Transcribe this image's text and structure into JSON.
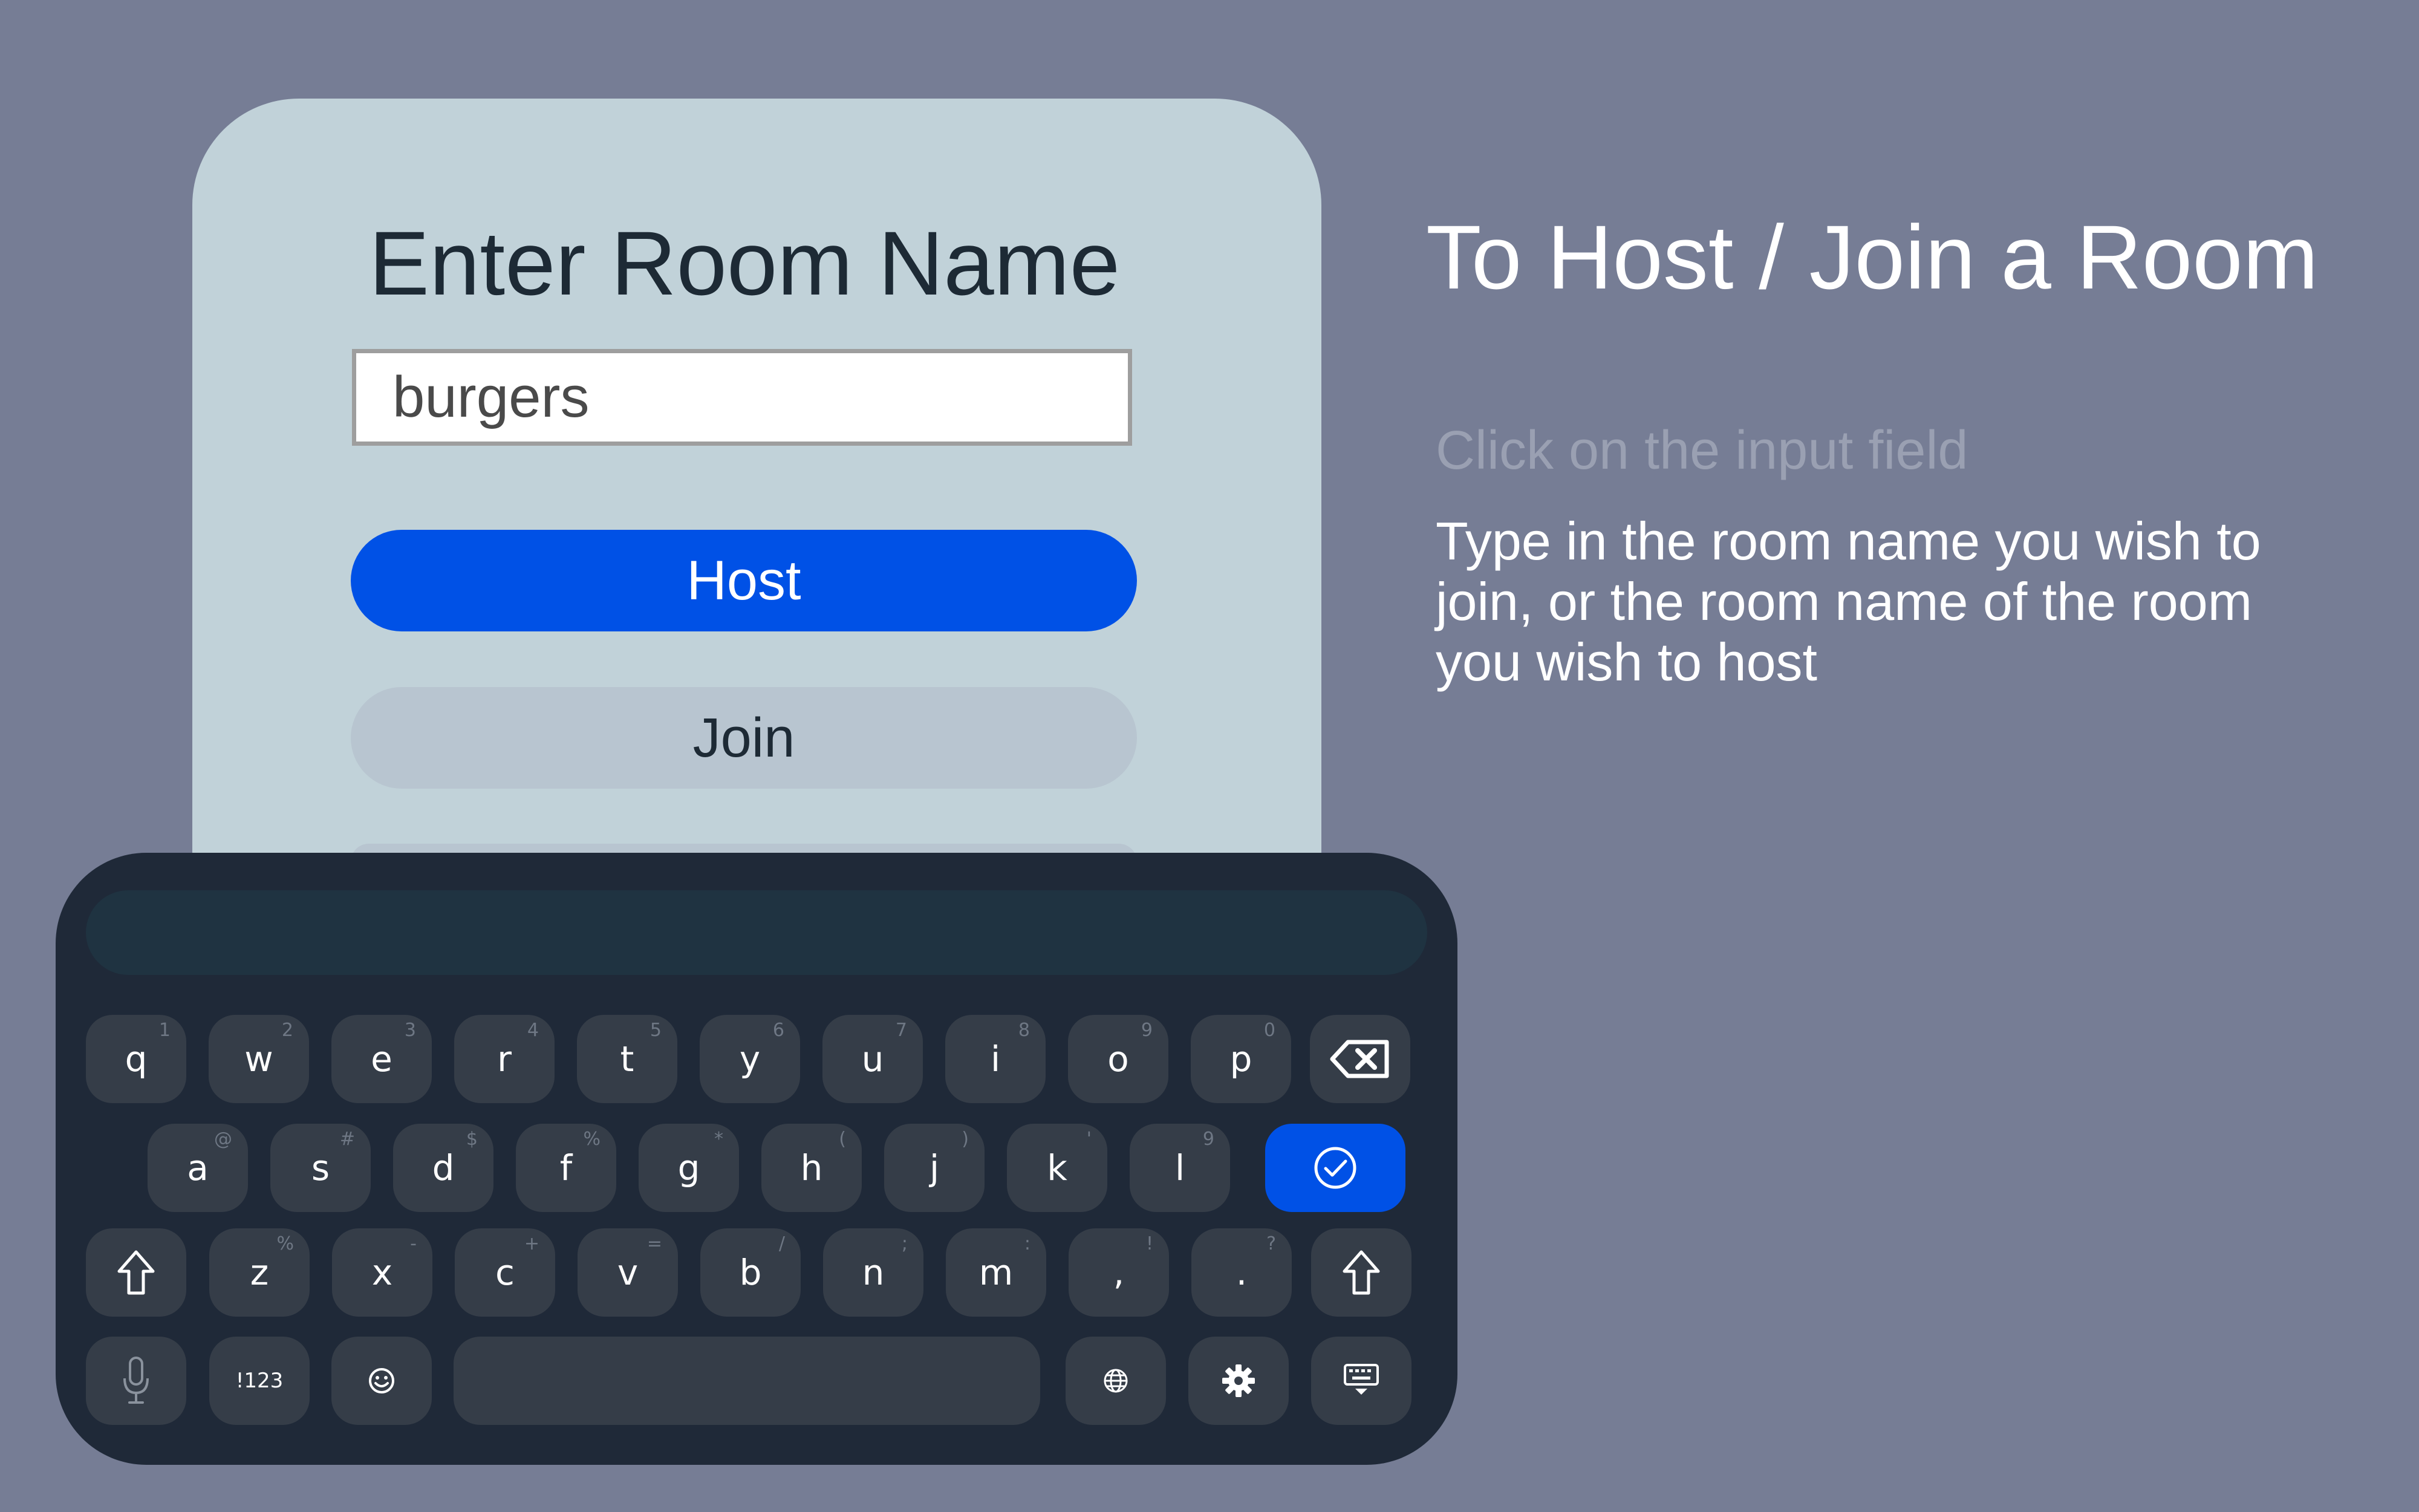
{
  "panel": {
    "title": "Enter Room Name",
    "input_value": "burgers",
    "host_label": "Host",
    "join_label": "Join"
  },
  "instructions": {
    "title": "To Host / Join a Room",
    "faded_step": "Click on the input field",
    "active_step": "Type in the room name you wish to join, or the room name of the room you wish to host"
  },
  "keyboard": {
    "row1": [
      {
        "label": "q",
        "sup": "1"
      },
      {
        "label": "w",
        "sup": "2"
      },
      {
        "label": "e",
        "sup": "3"
      },
      {
        "label": "r",
        "sup": "4"
      },
      {
        "label": "t",
        "sup": "5"
      },
      {
        "label": "y",
        "sup": "6"
      },
      {
        "label": "u",
        "sup": "7"
      },
      {
        "label": "i",
        "sup": "8"
      },
      {
        "label": "o",
        "sup": "9"
      },
      {
        "label": "p",
        "sup": "0"
      }
    ],
    "row2": [
      {
        "label": "a",
        "sup": "@"
      },
      {
        "label": "s",
        "sup": "#"
      },
      {
        "label": "d",
        "sup": "$"
      },
      {
        "label": "f",
        "sup": "%"
      },
      {
        "label": "g",
        "sup": "*"
      },
      {
        "label": "h",
        "sup": "("
      },
      {
        "label": "j",
        "sup": ")"
      },
      {
        "label": "k",
        "sup": "'"
      },
      {
        "label": "l",
        "sup": "9"
      }
    ],
    "row3": [
      {
        "label": "z",
        "sup": "%"
      },
      {
        "label": "x",
        "sup": "-"
      },
      {
        "label": "c",
        "sup": "+"
      },
      {
        "label": "v",
        "sup": "="
      },
      {
        "label": "b",
        "sup": "/"
      },
      {
        "label": "n",
        "sup": ";"
      },
      {
        "label": "m",
        "sup": ":"
      },
      {
        "label": ",",
        "sup": "!"
      },
      {
        "label": ".",
        "sup": "?"
      }
    ],
    "symbols_label": "!123",
    "icons": {
      "backspace": "backspace-icon",
      "enter": "check-circle-icon",
      "shift": "shift-icon",
      "mic": "microphone-icon",
      "emoji": "emoji-icon",
      "globe": "globe-icon",
      "settings": "gear-icon",
      "hide": "keyboard-hide-icon"
    }
  },
  "colors": {
    "background": "#767d95",
    "panel": "#c1d2d9",
    "accent": "#0051e6",
    "keyboard": "#1f2938",
    "key": "#353d48"
  }
}
